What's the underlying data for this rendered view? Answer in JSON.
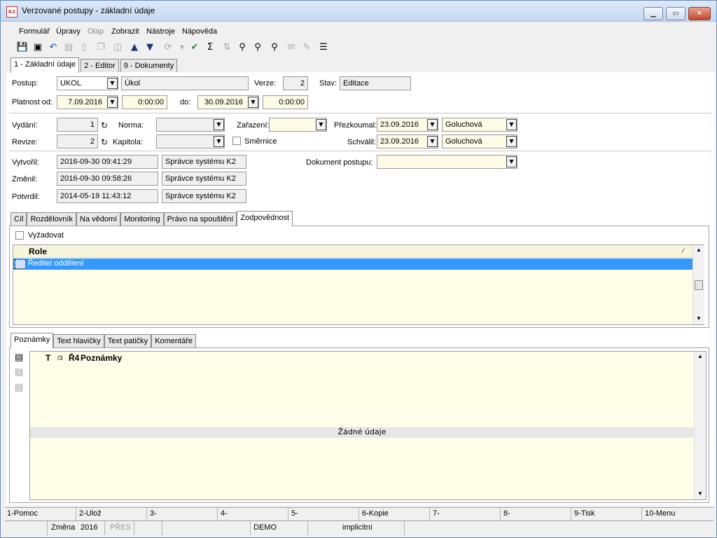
{
  "window": {
    "title": "Verzované postupy - základní údaje",
    "app_icon": "K2"
  },
  "menu": [
    "Formulář",
    "Úpravy",
    "Olap",
    "Zobrazit",
    "Nástroje",
    "Nápověda"
  ],
  "main_tabs": [
    "1 - Základní údaje",
    "2 - Editor",
    "9 - Dokumenty"
  ],
  "form": {
    "postup_label": "Postup:",
    "postup_code": "UKOL",
    "postup_name": "Úkol",
    "verze_label": "Verze:",
    "verze_value": "2",
    "stav_label": "Stav:",
    "stav_value": "Editace",
    "platnost_label": "Platnost od:",
    "platnost_od_date": "7.09.2016",
    "platnost_od_time": "0:00:00",
    "do_label": "do:",
    "do_date": "30.09.2016",
    "do_time": "0:00:00",
    "vydani_label": "Vydání:",
    "vydani_value": "1",
    "revize_label": "Revize:",
    "revize_value": "2",
    "norma_label": "Norma:",
    "kapitola_label": "Kapitola:",
    "zarazeni_label": "Zařazení:",
    "smernice_label": "Směrnice",
    "prezkoumal_label": "Přezkoumal:",
    "prezkoumal_date": "23.09.2016",
    "prezkoumal_name": "Goluchová",
    "schvalil_label": "Schválil:",
    "schvalil_date": "23.09.2016",
    "schvalil_name": "Goluchová",
    "vytvoril_label": "Vytvořil:",
    "vytvoril_ts": "2016-09-30 09:41:29",
    "vytvoril_user": "Správce systému K2",
    "zmenil_label": "Změnil:",
    "zmenil_ts": "2016-09-30 09:58:26",
    "zmenil_user": "Správce systému K2",
    "potvrdil_label": "Potvrdil:",
    "potvrdil_ts": "2014-05-19 11:43:12",
    "potvrdil_user": "Správce systému K2",
    "dokument_label": "Dokument postupu:"
  },
  "sub_tabs": [
    "Cíl",
    "Rozdělovník",
    "Na vědomí",
    "Monitoring",
    "Právo na spouštění",
    "Zodpovědnost"
  ],
  "zodpovednost": {
    "vyzadovat_label": "Vyžadovat",
    "column_header": "Role",
    "rows": [
      "Ředitel oddělení"
    ]
  },
  "note_tabs": [
    "Poznámky",
    "Text hlavičky",
    "Text patičky",
    "Komentáře"
  ],
  "notes": {
    "col_t": "T",
    "col_sort": "/3",
    "col_r": "Ř4",
    "column_header": "Poznámky",
    "empty_text": "Žádné údaje"
  },
  "fkeys": [
    "1-Pomoc",
    "2-Ulož",
    "3-",
    "4-",
    "5-",
    "6-Kopie",
    "7-",
    "8-",
    "9-Tisk",
    "10-Menu"
  ],
  "status": {
    "zmena": "Změna",
    "year": "2016",
    "pres": "PŘES",
    "db": "DEMO",
    "mode": "implicitní"
  }
}
